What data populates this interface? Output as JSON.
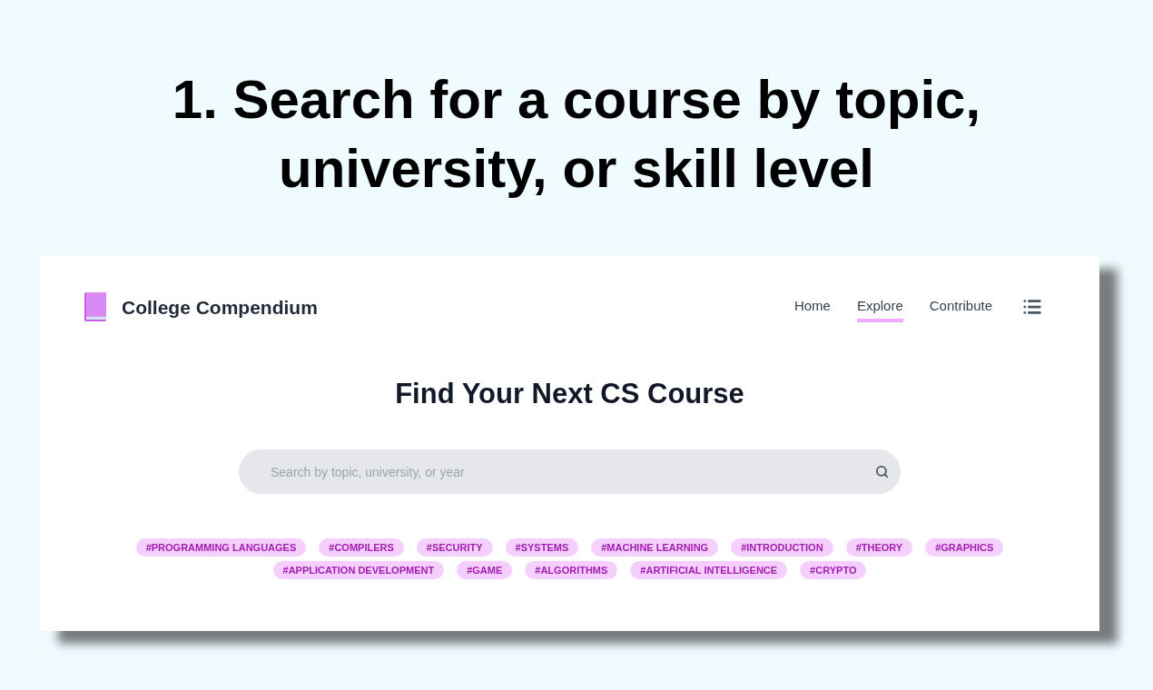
{
  "caption": "1. Search for a course by topic, university, or skill level",
  "header": {
    "brand": "College Compendium",
    "nav": [
      {
        "label": "Home",
        "selected": false
      },
      {
        "label": "Explore",
        "selected": true
      },
      {
        "label": "Contribute",
        "selected": false
      }
    ]
  },
  "hero": {
    "title": "Find Your Next CS Course"
  },
  "search": {
    "placeholder": "Search by topic, university, or year"
  },
  "tags": [
    "#PROGRAMMING LANGUAGES",
    "#COMPILERS",
    "#SECURITY",
    "#SYSTEMS",
    "#MACHINE LEARNING",
    "#INTRODUCTION",
    "#THEORY",
    "#GRAPHICS",
    "#APPLICATION DEVELOPMENT",
    "#GAME",
    "#ALGORITHMS",
    "#ARTIFICIAL INTELLIGENCE",
    "#CRYPTO"
  ]
}
